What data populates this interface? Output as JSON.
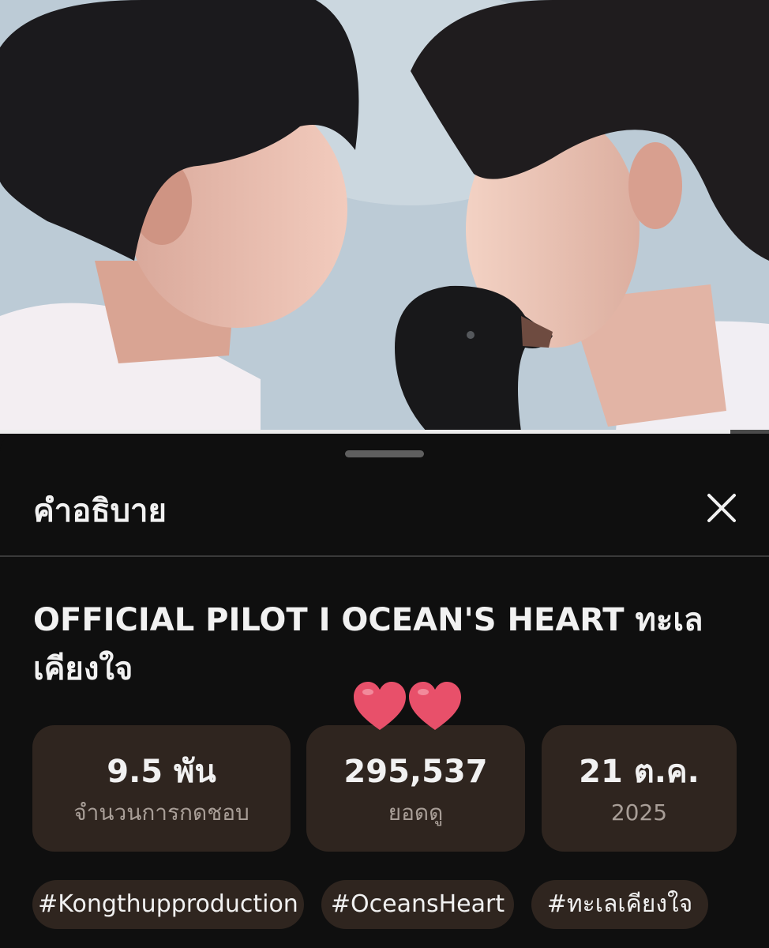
{
  "video": {
    "progress_fraction": 0.95
  },
  "sheet": {
    "title": "คำอธิบาย",
    "close_icon": "close-icon"
  },
  "description": {
    "video_title": "OFFICIAL PILOT I OCEAN'S HEART ทะเลเคียงใจ",
    "stats": [
      {
        "value": "9.5 พัน",
        "label": "จำนวนการกดชอบ"
      },
      {
        "value": "295,537",
        "label": "ยอดดู"
      },
      {
        "value": "21 ต.ค.",
        "label": "2025"
      }
    ],
    "hashtags": [
      "#Kongthupproduction",
      "#OceansHeart",
      "#ทะเลเคียงใจ"
    ]
  },
  "colors": {
    "background": "#0f0f0f",
    "chip_background": "#2f251f",
    "heart": "#e8506a"
  },
  "decorations": {
    "sticker": "two-hearts-sticker"
  }
}
